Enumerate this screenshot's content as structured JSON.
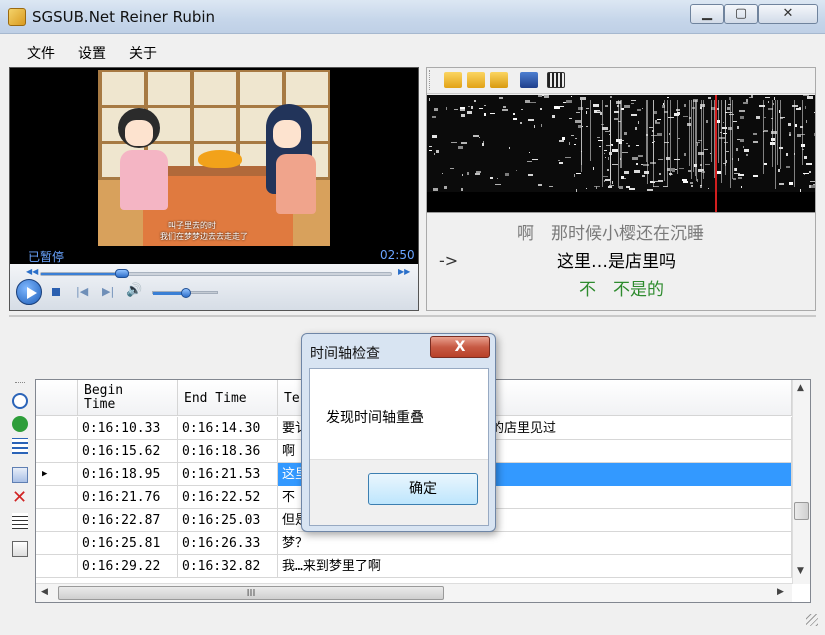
{
  "window": {
    "title": "SGSUB.Net Reiner Rubin"
  },
  "menu": {
    "file": "文件",
    "settings": "设置",
    "about": "关于"
  },
  "video": {
    "status": "已暂停",
    "time": "02:50",
    "burned_subtitle_line1": "叫子里去的时",
    "burned_subtitle_line2": "我们在梦梦边去去走走了",
    "seek_fraction": 0.23,
    "volume_fraction": 0.5
  },
  "subtitle_preview": {
    "prev": "啊　那时候小樱还在沉睡",
    "arrow": "->",
    "current": "这里…是店里吗",
    "next": "不　不是的"
  },
  "table": {
    "columns": [
      "Begin\nTime",
      "End Time",
      "Te"
    ],
    "rows": [
      {
        "begin": "0:16:10.33",
        "end": "0:16:14.30",
        "text": "要讠",
        "text_right": "的店里见过",
        "marker": ""
      },
      {
        "begin": "0:16:15.62",
        "end": "0:16:18.36",
        "text": "啊",
        "text_right": "",
        "marker": ""
      },
      {
        "begin": "0:16:18.95",
        "end": "0:16:21.53",
        "text": "这里",
        "text_right": "",
        "marker": "▶"
      },
      {
        "begin": "0:16:21.76",
        "end": "0:16:22.52",
        "text": "不",
        "text_right": "",
        "marker": ""
      },
      {
        "begin": "0:16:22.87",
        "end": "0:16:25.03",
        "text": "但是",
        "text_right": "",
        "marker": ""
      },
      {
        "begin": "0:16:25.81",
        "end": "0:16:26.33",
        "text": "梦？",
        "text_right": "",
        "marker": ""
      },
      {
        "begin": "0:16:29.22",
        "end": "0:16:32.82",
        "text": "我…来到梦里了啊",
        "text_right": "",
        "marker": ""
      }
    ],
    "hscroll_glyph": "III"
  },
  "dialog": {
    "title": "时间轴检查",
    "close_glyph": "X",
    "message": "发现时间轴重叠",
    "ok": "确定"
  },
  "colors": {
    "selection": "#3399ff",
    "accent_blue": "#6aa4ff",
    "next_line": "#2e8b2e",
    "playhead": "#d21f1f"
  }
}
